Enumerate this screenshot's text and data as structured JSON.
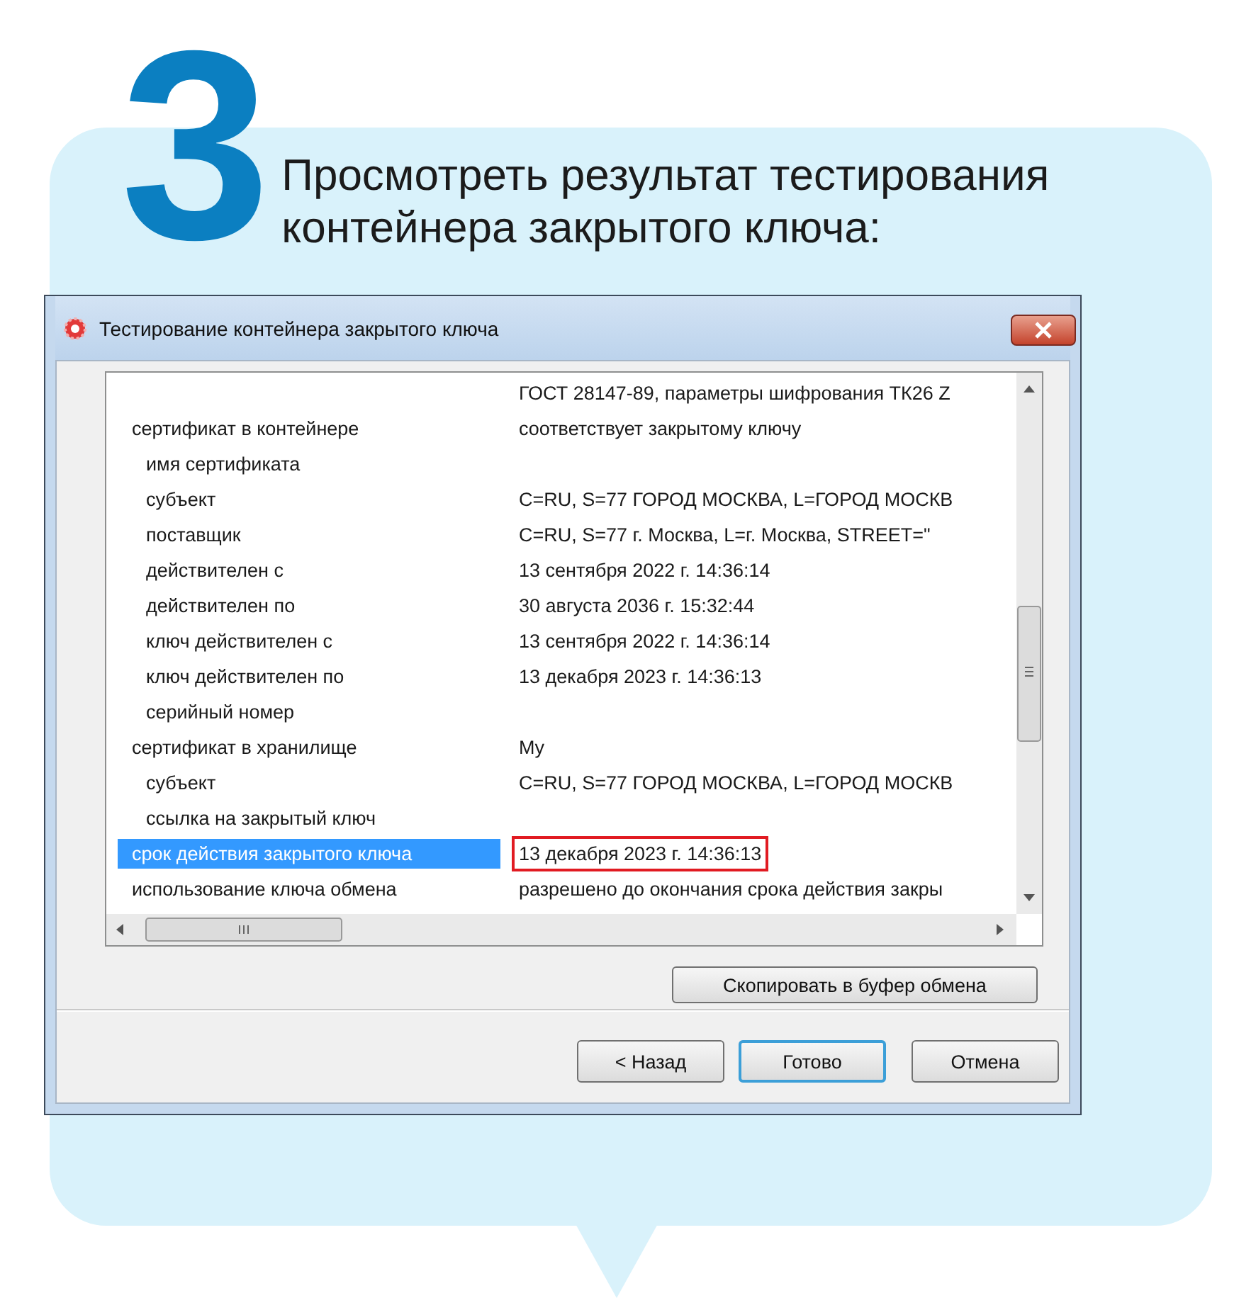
{
  "step_number": "3",
  "heading": "Просмотреть результат тестирования контейнера закрытого ключа:",
  "window": {
    "title": "Тестирование контейнера закрытого ключа"
  },
  "rows": [
    {
      "value": "ГОСТ 28147-89, параметры шифрования ТК26 Z",
      "selected": false
    },
    {
      "label": "сертификат в контейнере",
      "value": "соответствует закрытому ключу",
      "selected": false,
      "children": [
        {
          "label": "имя сертификата",
          "selected": false
        },
        {
          "label": "субъект",
          "value": "C=RU, S=77 ГОРОД МОСКВА, L=ГОРОД МОСКВ",
          "selected": false
        },
        {
          "label": "поставщик",
          "value": "C=RU, S=77 г. Москва, L=г. Москва, STREET=\"",
          "selected": false
        },
        {
          "label": "действителен с",
          "value": "13 сентября 2022 г. 14:36:14",
          "selected": false
        },
        {
          "label": "действителен по",
          "value": "30 августа 2036 г. 15:32:44",
          "selected": false
        },
        {
          "label": "ключ действителен с",
          "value": "13 сентября 2022 г. 14:36:14",
          "selected": false
        },
        {
          "label": "ключ действителен по",
          "value": "13 декабря 2023 г. 14:36:13",
          "selected": false
        },
        {
          "label": "серийный номер",
          "selected": false
        }
      ]
    },
    {
      "label": "сертификат в хранилище",
      "value": "My",
      "selected": false,
      "children": [
        {
          "label": "субъект",
          "value": "C=RU, S=77 ГОРОД МОСКВА, L=ГОРОД МОСКВ",
          "selected": false
        },
        {
          "label": "ссылка на закрытый ключ",
          "selected": false
        }
      ]
    },
    {
      "label": "срок действия закрытого ключа",
      "value": "13 декабря 2023 г. 14:36:13",
      "selected": true,
      "annotated": true
    },
    {
      "label": "использование ключа обмена",
      "value": "разрешено до окончания срока действия закры",
      "selected": false
    }
  ],
  "copy_button": {
    "label": "Скопировать в буфер обмена"
  },
  "buttons": [
    {
      "label": "< Назад",
      "default": false
    },
    {
      "label": "Готово",
      "default": true
    },
    {
      "label": "Отмена",
      "default": false
    }
  ]
}
